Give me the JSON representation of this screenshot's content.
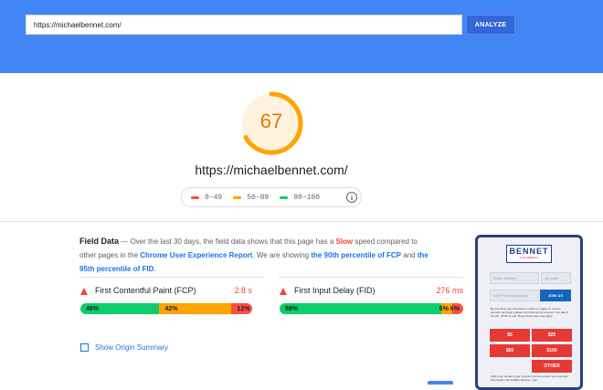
{
  "search": {
    "url_value": "https://michaelbennet.com/",
    "analyze_label": "ANALYZE"
  },
  "score": {
    "value": "67",
    "fraction": 0.67,
    "color": "#ffa400"
  },
  "page_url": "https://michaelbennet.com/",
  "legend": {
    "items": [
      {
        "label": "0–49",
        "color": "#ff4e42"
      },
      {
        "label": "50–89",
        "color": "#ffa400"
      },
      {
        "label": "90–100",
        "color": "#0cce6b"
      }
    ],
    "info_icon": "i"
  },
  "field_data": {
    "title": "Field Data",
    "text1": " — Over the last 30 days, the field data shows that this page has a ",
    "slow": "Slow",
    "text2": " speed compared to other pages in the ",
    "link1": "Chrome User Experience Report",
    "text3": ". We are showing ",
    "link2": "the 90th percentile of FCP",
    "text4": " and ",
    "link3": "the 95th percentile of FID",
    "text5": "."
  },
  "metrics": {
    "fcp": {
      "name": "First Contentful Paint (FCP)",
      "value": "2.8 s",
      "fast": "46%",
      "average": "42%",
      "slow": "12%",
      "fast_frac": 0.46,
      "average_frac": 0.42,
      "slow_frac": 0.12
    },
    "fid": {
      "name": "First Input Delay (FID)",
      "value": "276 ms",
      "fast": "88%",
      "average": "6%",
      "slow": "6%",
      "fast_frac": 0.88,
      "average_frac": 0.06,
      "slow_frac": 0.06
    }
  },
  "origin_summary": "Show Origin Summary",
  "thumbnail": {
    "logo": "BENNET",
    "logo_sub": "FOR AMERICA",
    "email_placeholder": "Email address",
    "zip_placeholder": "Zip code",
    "phone_placeholder": "Cell Phone (optional)",
    "join_label": "JOIN US",
    "disclaimer": "By providing your cell phone number you agree to receive periodic campaign updates from Bennet for America. Text HELP for info, STOP to end. Msg & Data rates may apply.",
    "amounts": [
      "$5",
      "$25",
      "$50",
      "$100",
      "OTHER"
    ],
    "footer": "Click to an update to get records if you've entered your payment information with ActBlue Express, your"
  }
}
